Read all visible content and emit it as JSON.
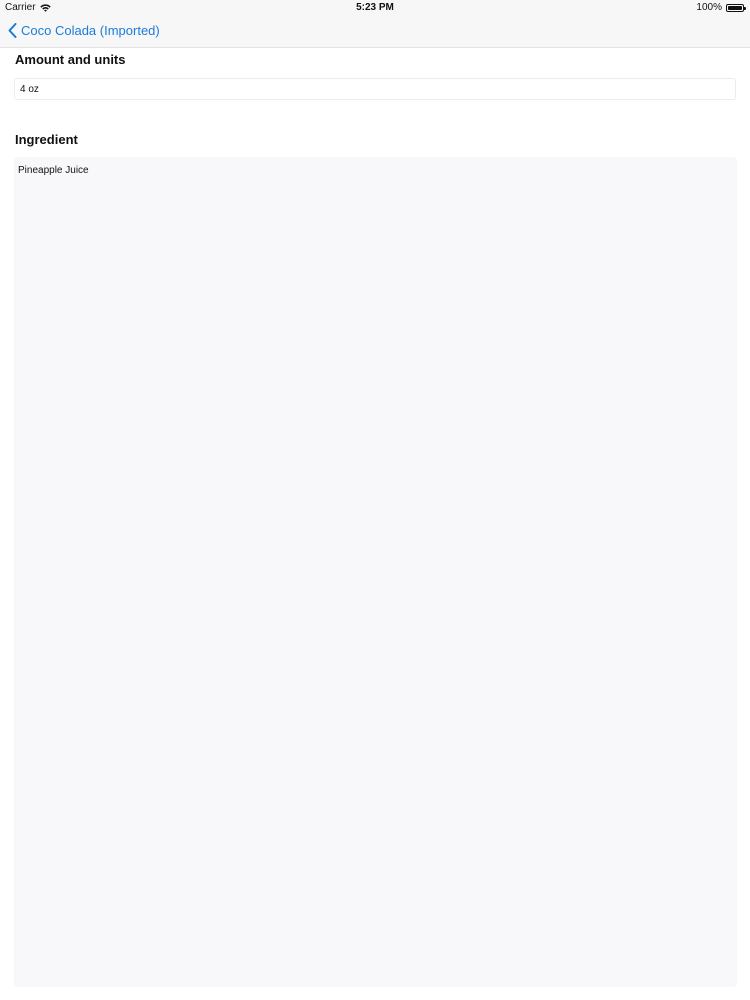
{
  "status_bar": {
    "carrier": "Carrier",
    "time": "5:23 PM",
    "battery": "100%",
    "battery_level": 1.0
  },
  "nav": {
    "back_label": "Coco Colada (Imported)",
    "back_icon": "chevron-left-icon",
    "accent_color": "#1a7bdc"
  },
  "amount": {
    "label": "Amount and units",
    "value": "4 oz"
  },
  "ingredient": {
    "label": "Ingredient",
    "value": "Pineapple Juice"
  }
}
